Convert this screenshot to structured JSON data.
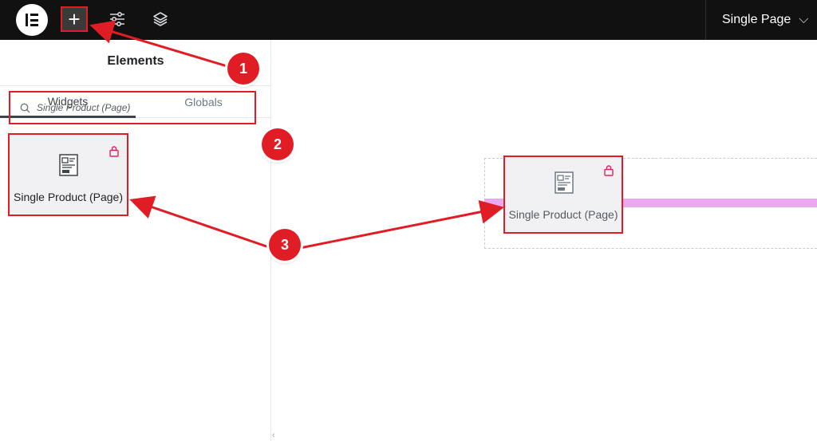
{
  "topbar": {
    "logo_icon": "elementor-logo-icon",
    "add_icon": "plus-icon",
    "add_label": "+",
    "settings_icon": "sliders-icon",
    "layers_icon": "layers-icon",
    "page_select_label": "Single Page",
    "page_select_icon": "chevron-down-icon",
    "chevron": "⌵"
  },
  "panel": {
    "title": "Elements",
    "tabs": [
      {
        "label": "Widgets",
        "active": true
      },
      {
        "label": "Globals",
        "active": false
      }
    ],
    "search": {
      "icon": "search-icon",
      "value": "Single Product (Page)"
    },
    "widgets": [
      {
        "label": "Single Product (Page)",
        "icon": "single-product-icon",
        "badge_icon": "pro-lock-icon"
      }
    ]
  },
  "canvas": {
    "dragged_widget": {
      "label": "Single Product (Page)",
      "icon": "single-product-icon",
      "badge_icon": "pro-lock-icon"
    },
    "collapse_icon": "‹"
  },
  "annotations": {
    "step_1": "1",
    "step_2": "2",
    "step_3": "3",
    "color": "#e01c24"
  },
  "colors": {
    "topbar_bg": "#111111",
    "accent_red": "#e01c24",
    "drop_indicator": "#e9a8f0"
  }
}
